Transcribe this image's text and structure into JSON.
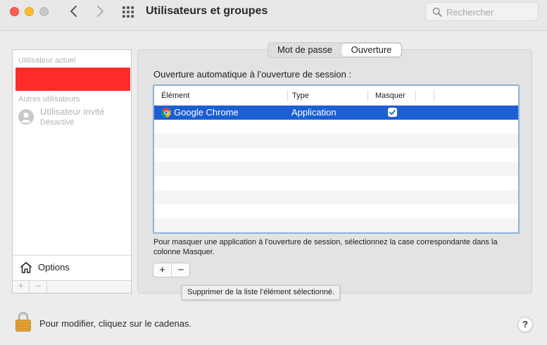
{
  "window": {
    "title": "Utilisateurs et groupes",
    "search_placeholder": "Rechercher"
  },
  "users_panel": {
    "current_header": "Utilisateur actuel",
    "others_header": "Autres utilisateurs",
    "guest_name": "Utilisateur invité",
    "guest_status": "Désactivé",
    "options_label": "Options",
    "add_label": "+",
    "remove_label": "−"
  },
  "tabs": [
    {
      "label": "Mot de passe",
      "selected": false
    },
    {
      "label": "Ouverture",
      "selected": true
    }
  ],
  "login_items": {
    "section_label": "Ouverture automatique à l’ouverture de session :",
    "columns": [
      "Élément",
      "Type",
      "Masquer"
    ],
    "rows": [
      {
        "name": "Google Chrome",
        "type": "Application",
        "hidden": true
      }
    ],
    "hint": "Pour masquer une application à l’ouverture de session, sélectionnez la case correspondante dans la colonne Masquer.",
    "add_label": "+",
    "remove_label": "−",
    "tooltip": "Supprimer de la liste l’élément sélectionné."
  },
  "footer": {
    "lock_text": "Pour modifier, cliquez sur le cadenas.",
    "help_label": "?"
  },
  "colors": {
    "selection": "#1b5fd3",
    "current_user_redacted": "#ff2a2a",
    "table_focus_ring": "#92aee0"
  }
}
